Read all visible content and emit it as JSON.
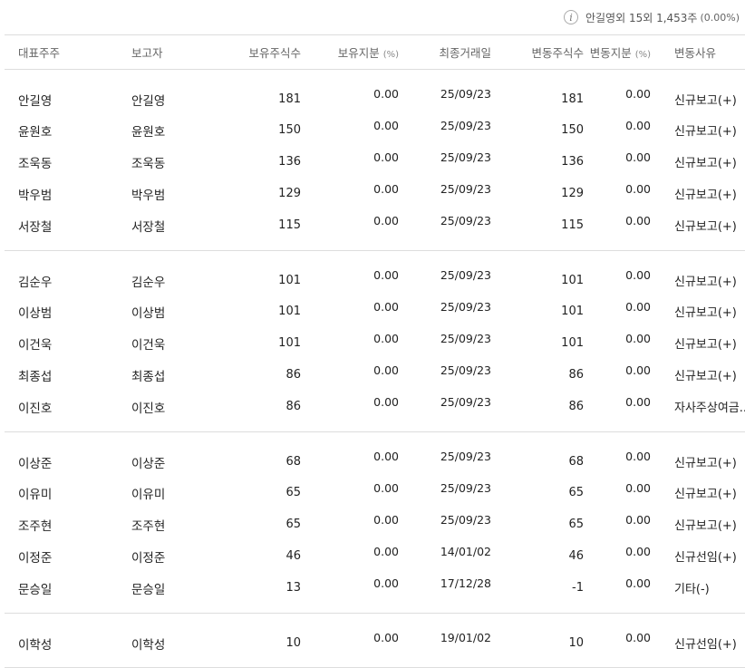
{
  "summary": {
    "text": "안길영외 15외 1,453주",
    "pct": "(0.00%)"
  },
  "columns": [
    "대표주주",
    "보고자",
    "보유주식수",
    "보유지분",
    "최종거래일",
    "변동주식수",
    "변동지분",
    "변동사유"
  ],
  "unit": "(%)",
  "groups": [
    [
      [
        "안길영",
        "안길영",
        "181",
        "0.00",
        "25/09/23",
        "181",
        "0.00",
        "신규보고(+)"
      ],
      [
        "윤원호",
        "윤원호",
        "150",
        "0.00",
        "25/09/23",
        "150",
        "0.00",
        "신규보고(+)"
      ],
      [
        "조욱동",
        "조욱동",
        "136",
        "0.00",
        "25/09/23",
        "136",
        "0.00",
        "신규보고(+)"
      ],
      [
        "박우범",
        "박우범",
        "129",
        "0.00",
        "25/09/23",
        "129",
        "0.00",
        "신규보고(+)"
      ],
      [
        "서장철",
        "서장철",
        "115",
        "0.00",
        "25/09/23",
        "115",
        "0.00",
        "신규보고(+)"
      ]
    ],
    [
      [
        "김순우",
        "김순우",
        "101",
        "0.00",
        "25/09/23",
        "101",
        "0.00",
        "신규보고(+)"
      ],
      [
        "이상범",
        "이상범",
        "101",
        "0.00",
        "25/09/23",
        "101",
        "0.00",
        "신규보고(+)"
      ],
      [
        "이건욱",
        "이건욱",
        "101",
        "0.00",
        "25/09/23",
        "101",
        "0.00",
        "신규보고(+)"
      ],
      [
        "최종섭",
        "최종섭",
        "86",
        "0.00",
        "25/09/23",
        "86",
        "0.00",
        "신규보고(+)"
      ],
      [
        "이진호",
        "이진호",
        "86",
        "0.00",
        "25/09/23",
        "86",
        "0.00",
        "자사주상여금.."
      ]
    ],
    [
      [
        "이상준",
        "이상준",
        "68",
        "0.00",
        "25/09/23",
        "68",
        "0.00",
        "신규보고(+)"
      ],
      [
        "이유미",
        "이유미",
        "65",
        "0.00",
        "25/09/23",
        "65",
        "0.00",
        "신규보고(+)"
      ],
      [
        "조주현",
        "조주현",
        "65",
        "0.00",
        "25/09/23",
        "65",
        "0.00",
        "신규보고(+)"
      ],
      [
        "이정준",
        "이정준",
        "46",
        "0.00",
        "14/01/02",
        "46",
        "0.00",
        "신규선임(+)"
      ],
      [
        "문승일",
        "문승일",
        "13",
        "0.00",
        "17/12/28",
        "-1",
        "0.00",
        "기타(-)"
      ]
    ],
    [
      [
        "이학성",
        "이학성",
        "10",
        "0.00",
        "19/01/02",
        "10",
        "0.00",
        "신규선임(+)"
      ]
    ]
  ]
}
